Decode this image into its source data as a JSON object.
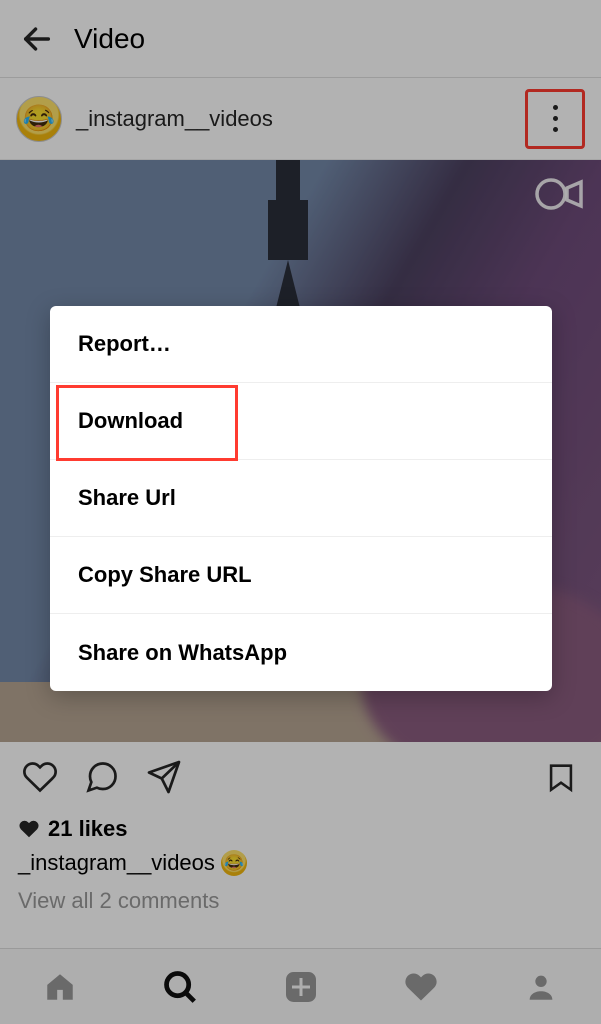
{
  "header": {
    "title": "Video"
  },
  "profile": {
    "username": "_instagram__videos",
    "avatar_emoji": "😂"
  },
  "menu": {
    "items": [
      {
        "label": "Report…"
      },
      {
        "label": "Download"
      },
      {
        "label": "Share Url"
      },
      {
        "label": "Copy Share URL"
      },
      {
        "label": "Share on WhatsApp"
      }
    ]
  },
  "post": {
    "likes_text": "21 likes",
    "caption_user": "_instagram__videos",
    "caption_emoji": "😂",
    "view_comments": "View all 2 comments"
  },
  "highlight_color": "#ff3b30"
}
